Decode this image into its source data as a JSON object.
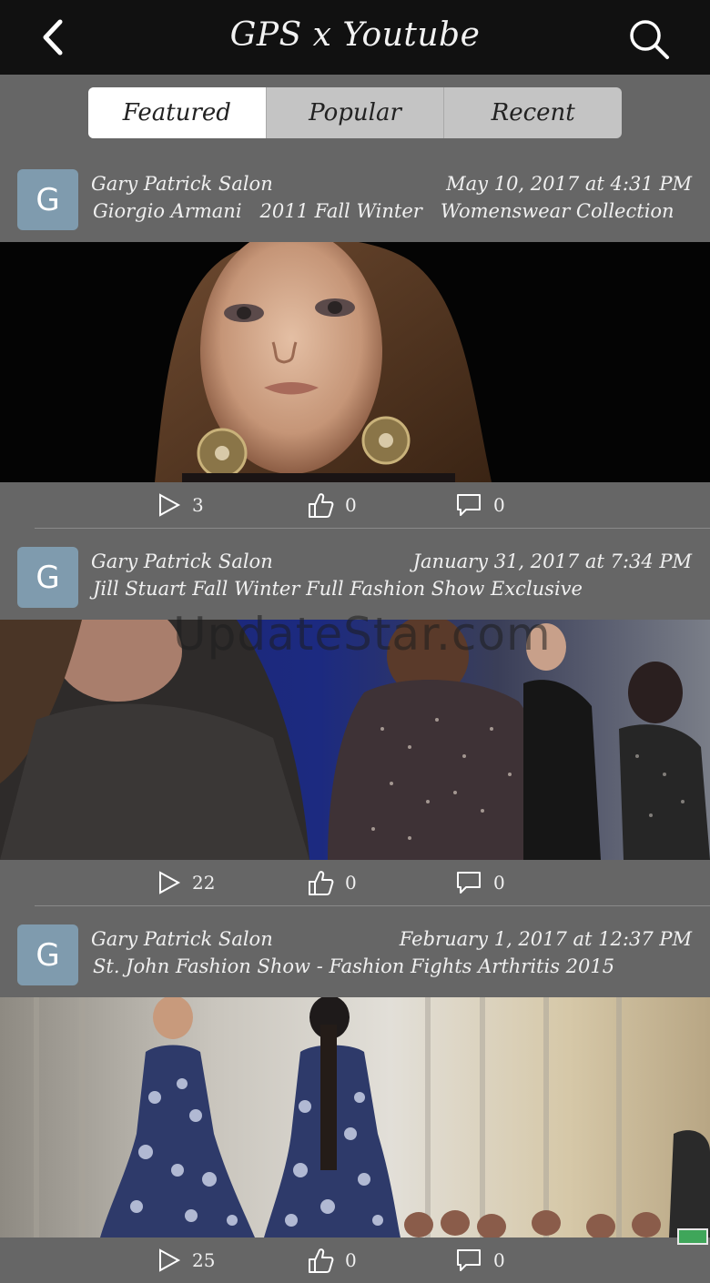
{
  "header": {
    "back_icon": "chevron-left-icon",
    "title": "GPS x Youtube",
    "search_icon": "search-icon"
  },
  "tabs": [
    {
      "label": "Featured",
      "selected": true
    },
    {
      "label": "Popular",
      "selected": false
    },
    {
      "label": "Recent",
      "selected": false
    }
  ],
  "posts": [
    {
      "avatar": "G",
      "author": "Gary Patrick Salon",
      "date": "May 10, 2017 at 4:31 PM",
      "title": "Giorgio Armani   2011 Fall Winter   Womenswear Collection",
      "views": "3",
      "likes": "0",
      "comments": "0"
    },
    {
      "avatar": "G",
      "author": "Gary Patrick Salon",
      "date": "January 31, 2017 at 7:34 PM",
      "title": "Jill Stuart Fall Winter Full Fashion Show Exclusive",
      "views": "22",
      "likes": "0",
      "comments": "0"
    },
    {
      "avatar": "G",
      "author": "Gary Patrick Salon",
      "date": "February 1, 2017 at 12:37 PM",
      "title": "St. John Fashion Show - Fashion Fights Arthritis 2015",
      "views": "25",
      "likes": "0",
      "comments": "0"
    }
  ],
  "watermark": "UpdateStar.com",
  "colors": {
    "header_bg": "#111111",
    "page_bg": "#666666",
    "avatar_bg": "#7f9bae",
    "tab_selected": "#ffffff",
    "tab_unselected": "#c4c4c4"
  }
}
